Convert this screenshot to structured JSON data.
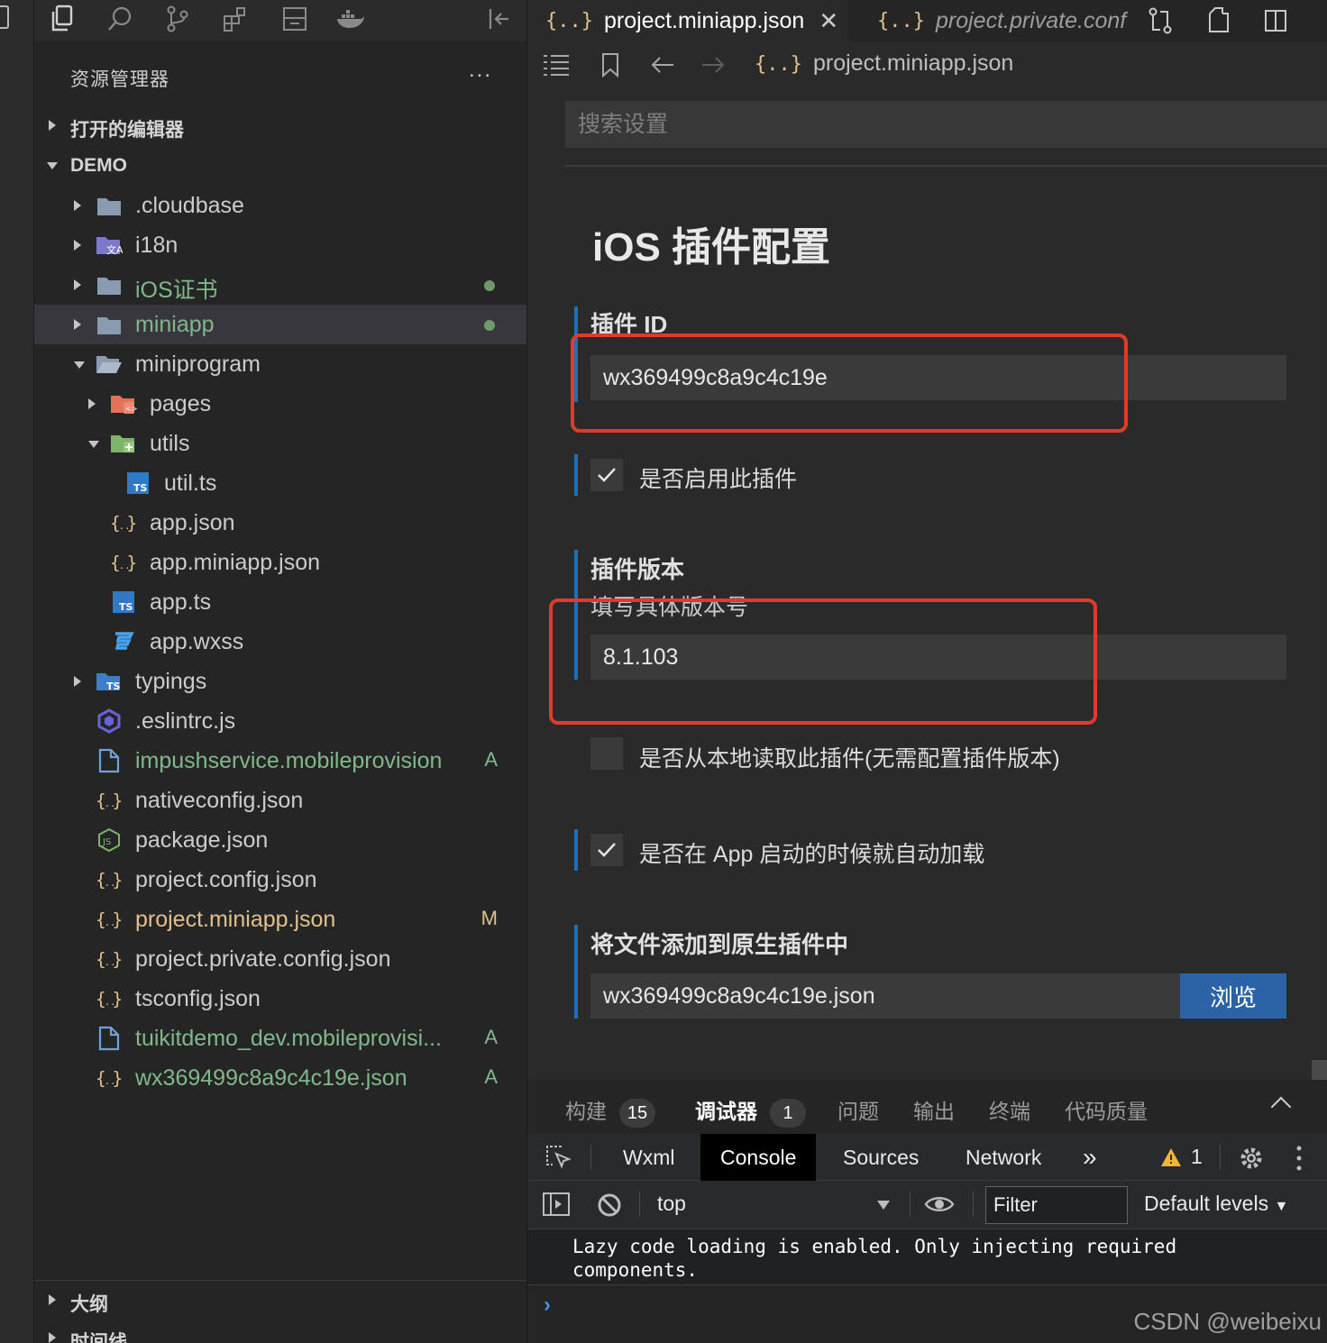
{
  "explorer": {
    "title": "资源管理器",
    "more": "...",
    "open_editors": "打开的编辑器",
    "root": "DEMO",
    "items": [
      {
        "name": ".cloudbase",
        "icon": "folder-icon",
        "indent": 0,
        "expandable": "right"
      },
      {
        "name": "i18n",
        "icon": "i18n-folder-icon",
        "indent": 0,
        "expandable": "right"
      },
      {
        "name": "iOS证书",
        "icon": "folder-icon",
        "indent": 0,
        "expandable": "right",
        "color": "green",
        "dot": true
      },
      {
        "name": "miniapp",
        "icon": "folder-icon",
        "indent": 0,
        "expandable": "right",
        "color": "green",
        "dot": true,
        "selected": true
      },
      {
        "name": "miniprogram",
        "icon": "folder-open-icon",
        "indent": 0,
        "expandable": "down"
      },
      {
        "name": "pages",
        "icon": "pages-folder-icon",
        "indent": 1,
        "expandable": "right"
      },
      {
        "name": "utils",
        "icon": "utils-folder-icon",
        "indent": 1,
        "expandable": "down"
      },
      {
        "name": "util.ts",
        "icon": "ts-file-icon",
        "indent": 2
      },
      {
        "name": "app.json",
        "icon": "json-file-icon",
        "indent": 1
      },
      {
        "name": "app.miniapp.json",
        "icon": "json-file-icon",
        "indent": 1
      },
      {
        "name": "app.ts",
        "icon": "ts-file-icon",
        "indent": 1
      },
      {
        "name": "app.wxss",
        "icon": "css-file-icon",
        "indent": 1
      },
      {
        "name": "typings",
        "icon": "ts-folder-icon",
        "indent": 0,
        "expandable": "right"
      },
      {
        "name": ".eslintrc.js",
        "icon": "eslint-file-icon",
        "indent": 0
      },
      {
        "name": "impushservice.mobileprovision",
        "icon": "file-icon",
        "indent": 0,
        "color": "green",
        "badge": "A"
      },
      {
        "name": "nativeconfig.json",
        "icon": "json-file-icon",
        "indent": 0
      },
      {
        "name": "package.json",
        "icon": "node-file-icon",
        "indent": 0
      },
      {
        "name": "project.config.json",
        "icon": "json-file-icon",
        "indent": 0
      },
      {
        "name": "project.miniapp.json",
        "icon": "json-file-icon",
        "indent": 0,
        "color": "yellow",
        "badge": "M"
      },
      {
        "name": "project.private.config.json",
        "icon": "json-file-icon",
        "indent": 0
      },
      {
        "name": "tsconfig.json",
        "icon": "json-file-icon",
        "indent": 0
      },
      {
        "name": "tuikitdemo_dev.mobileprovisi...",
        "icon": "file-icon",
        "indent": 0,
        "color": "green",
        "badge": "A"
      },
      {
        "name": "wx369499c8a9c4c19e.json",
        "icon": "json-file-icon",
        "indent": 0,
        "color": "green",
        "badge": "A"
      }
    ],
    "outline": "大纲",
    "timeline": "时间线"
  },
  "tabs": {
    "active": "project.miniapp.json",
    "inactive": "project.private.conf",
    "braces": "{..}",
    "close": "✕"
  },
  "breadcrumb": {
    "file": "project.miniapp.json"
  },
  "settings": {
    "search_placeholder": "搜索设置",
    "title": "iOS 插件配置",
    "plugin_id_label": "插件 ID",
    "plugin_id_value": "wx369499c8a9c4c19e",
    "enable_label": "是否启用此插件",
    "version_label": "插件版本",
    "version_desc": "填写具体版本号",
    "version_value": "8.1.103",
    "local_label": "是否从本地读取此插件(无需配置插件版本)",
    "autoload_label": "是否在 App 启动的时候就自动加载",
    "add_files_label": "将文件添加到原生插件中",
    "add_files_value": "wx369499c8a9c4c19e.json",
    "browse": "浏览"
  },
  "panel": {
    "tabs": [
      {
        "label": "构建",
        "count": "15"
      },
      {
        "label": "调试器",
        "count": "1",
        "active": true
      },
      {
        "label": "问题"
      },
      {
        "label": "输出"
      },
      {
        "label": "终端"
      },
      {
        "label": "代码质量"
      }
    ],
    "devtools_tabs": [
      "Wxml",
      "Console",
      "Sources",
      "Network"
    ],
    "devtools_active": "Console",
    "more_tabs": "»",
    "warnings": "1",
    "context": "top",
    "filter_placeholder": "Filter",
    "levels": "Default levels",
    "message": "Lazy code loading is enabled. Only injecting required components.",
    "prompt": "›"
  },
  "watermark": "CSDN @weibeixu",
  "colors": {
    "accent": "#1f6fb5",
    "highlight": "#e03a2c",
    "git_added": "#81b88b",
    "git_modified": "#e2c08d"
  }
}
